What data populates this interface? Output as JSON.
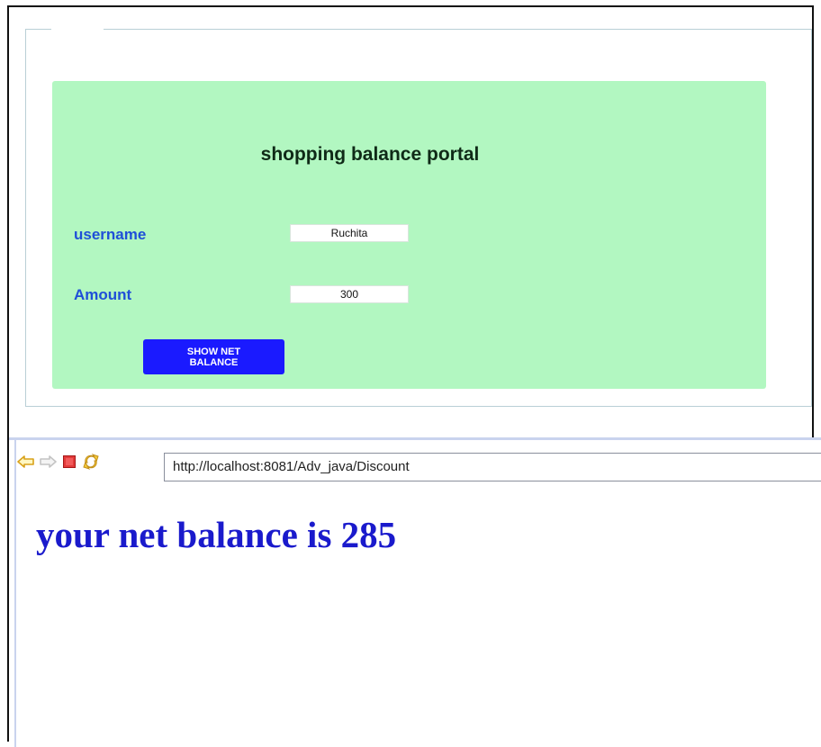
{
  "form": {
    "title": "shopping balance portal",
    "username_label": "username",
    "username_value": "Ruchita",
    "amount_label": "Amount",
    "amount_value": "300",
    "submit_label": "SHOW NET BALANCE",
    "card_color": "#b2f7c1",
    "button_color": "#1a1aff"
  },
  "browser": {
    "url": "http://localhost:8081/Adv_java/Discount",
    "icons": [
      "back-arrow-icon",
      "forward-arrow-icon",
      "stop-icon",
      "refresh-icon"
    ]
  },
  "result": {
    "message": "your net balance is 285",
    "color": "#1a1acc"
  }
}
